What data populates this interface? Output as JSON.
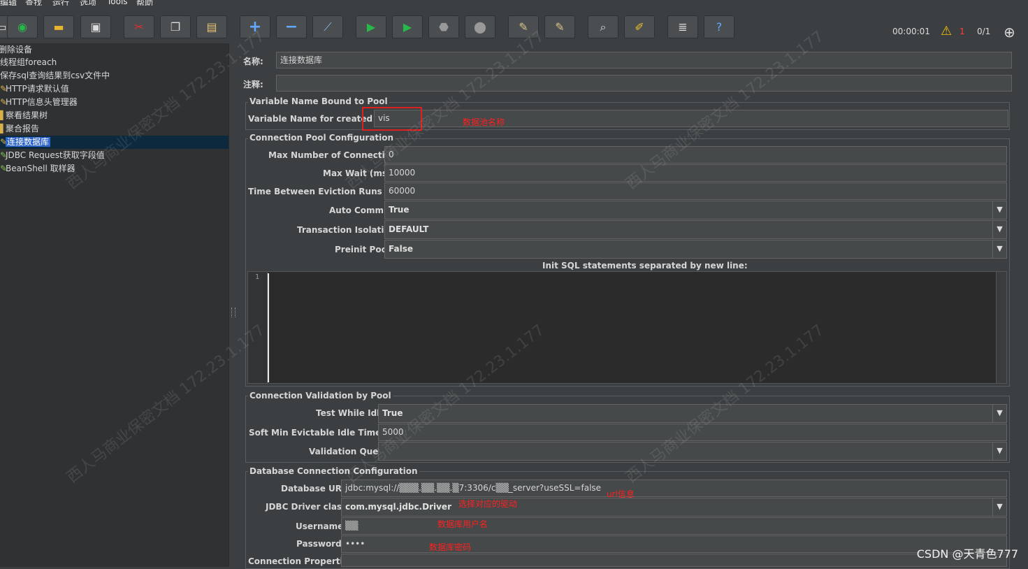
{
  "menu": [
    "编辑",
    "查找",
    "运行",
    "选项",
    "Tools",
    "帮助"
  ],
  "toolbar": {
    "timer": "00:00:01",
    "warning_count": "1",
    "threads": "0/1"
  },
  "tree": {
    "items": [
      {
        "label": "删除设备"
      },
      {
        "label": "线程组foreach"
      },
      {
        "label": "保存sql查询结果到csv文件中"
      },
      {
        "label": "HTTP请求默认值"
      },
      {
        "label": "HTTP信息头管理器"
      },
      {
        "label": "察看结果树"
      },
      {
        "label": "聚合报告"
      },
      {
        "label": "连接数据库",
        "selected": true
      },
      {
        "label": "JDBC Request获取字段值"
      },
      {
        "label": "BeanShell 取样器"
      }
    ]
  },
  "form": {
    "name_label": "名称:",
    "name_value": "连接数据库",
    "comment_label": "注释:",
    "comment_value": "",
    "pool_group_title": "Variable Name Bound to Pool",
    "pool_var_label": "Variable Name for created pool:",
    "pool_var_value": "vis",
    "conn_group_title": "Connection Pool Configuration",
    "max_conn_label": "Max Number of Connections:",
    "max_conn_value": "0",
    "max_wait_label": "Max Wait (ms):",
    "max_wait_value": "10000",
    "eviction_label": "Time Between Eviction Runs (ms):",
    "eviction_value": "60000",
    "auto_commit_label": "Auto Commit:",
    "auto_commit_value": "True",
    "isolation_label": "Transaction Isolation:",
    "isolation_value": "DEFAULT",
    "preinit_label": "Preinit Pool:",
    "preinit_value": "False",
    "init_sql_label": "Init SQL statements separated by new line:",
    "init_sql_line": "1",
    "valid_group_title": "Connection Validation by Pool",
    "test_idle_label": "Test While Idle:",
    "test_idle_value": "True",
    "soft_min_label": "Soft Min Evictable Idle Time(ms):",
    "soft_min_value": "5000",
    "valid_query_label": "Validation Query:",
    "valid_query_value": "",
    "db_group_title": "Database Connection Configuration",
    "db_url_label": "Database URL:",
    "db_url_value": "jdbc:mysql://▒▒▒.▒▒.▒▒.▒7:3306/c▒▒_server?useSSL=false",
    "driver_label": "JDBC Driver class:",
    "driver_value": "com.mysql.jdbc.Driver",
    "username_label": "Username:",
    "username_value": "▒▒",
    "password_label": "Password:",
    "password_value": "••••",
    "conn_props_label": "Connection Properties:"
  },
  "annotations": {
    "pool_name": "数据池名称",
    "url": "url信息",
    "driver": "选择对应的驱动",
    "username": "数据库用户名",
    "password": "数据库密码"
  },
  "watermark": "西人马商业保密文档 172.23.1.177",
  "credit": "CSDN @天青色777"
}
